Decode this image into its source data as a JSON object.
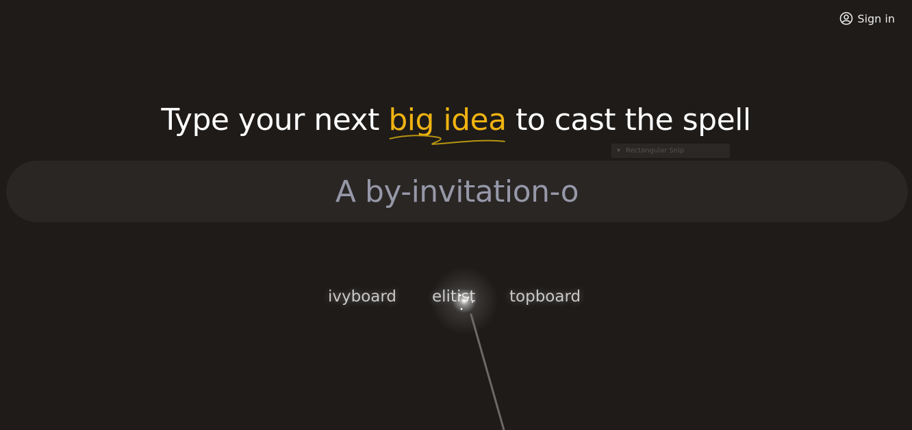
{
  "header": {
    "sign_in_label": "Sign in",
    "sign_in_icon": "user-circle-icon"
  },
  "hero": {
    "title_before": "Type your next ",
    "title_highlight": "big idea",
    "title_after": " to cast the spell",
    "highlight_color": "#f0b311"
  },
  "snip_overlay": {
    "label": "Rectangular Snip"
  },
  "search": {
    "value": "A by-invitation-o"
  },
  "suggestions": [
    {
      "label": "ivyboard"
    },
    {
      "label": "elitist"
    },
    {
      "label": "topboard"
    }
  ],
  "colors": {
    "background": "#1e1b19",
    "input_background": "#292624",
    "input_text": "#9698a8",
    "accent": "#f0b311"
  }
}
